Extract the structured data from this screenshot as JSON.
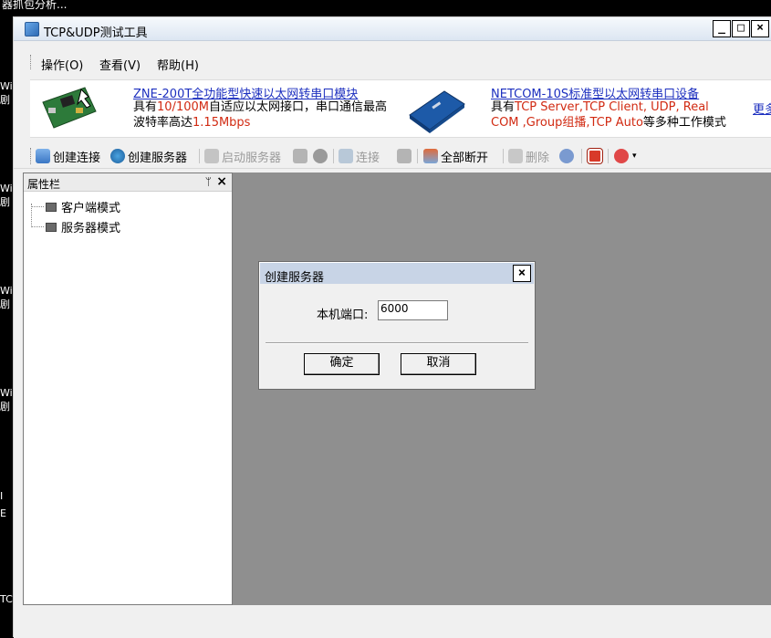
{
  "desktop": {
    "top_text": "器抓包分析...",
    "fragments": [
      "Wi",
      "剧",
      "Wi",
      "剧",
      "Wi",
      "剧",
      "Wi",
      "剧",
      "I",
      "E",
      "TC"
    ]
  },
  "window": {
    "title": "TCP&UDP测试工具",
    "minimize": "_",
    "maximize": "□",
    "close": "×"
  },
  "menu": {
    "items": [
      "操作(O)",
      "查看(V)",
      "帮助(H)"
    ]
  },
  "banner": {
    "ad1": {
      "link": "ZNE-200T全功能型快速以太网转串口模块",
      "line1_prefix": "具有",
      "line1_highlight": "10/100M",
      "line1_suffix": "自适应以太网接口，串口通信最高",
      "line2_prefix": "波特率高达",
      "line2_highlight": "1.15Mbps"
    },
    "ad2": {
      "link": "NETCOM-10S标准型以太网转串口设备",
      "line1_prefix": "具有",
      "line1_highlight": "TCP Server,TCP Client, UDP, Real",
      "line2_highlight": "COM ,Group组播,TCP Auto",
      "line2_suffix": "等多种工作模式"
    },
    "more": "更多"
  },
  "toolbar": {
    "create_connection": "创建连接",
    "create_server": "创建服务器",
    "start_server": "启动服务器",
    "connect": "连接",
    "disconnect_all": "全部断开",
    "delete": "删除"
  },
  "property_panel": {
    "title": "属性栏",
    "pin": "ᛘ",
    "close": "×",
    "items": [
      "客户端模式",
      "服务器模式"
    ]
  },
  "dialog": {
    "title": "创建服务器",
    "close": "×",
    "port_label": "本机端口:",
    "port_value": "6000",
    "ok": "确定",
    "cancel": "取消"
  },
  "colors": {
    "link": "#1c2fbf",
    "highlight": "#d12a12",
    "workspace": "#8f8f8f",
    "dialog_title": "#c8d4e6"
  }
}
